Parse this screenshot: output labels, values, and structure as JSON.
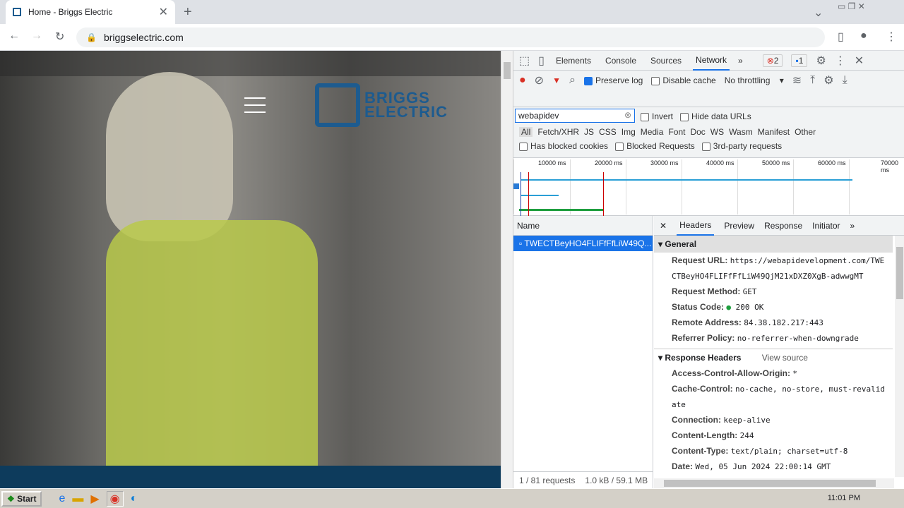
{
  "browser": {
    "tab_title": "Home - Briggs Electric",
    "url": "briggselectric.com"
  },
  "site": {
    "logo_line1": "BRIGGS",
    "logo_line2": "ELECTRIC"
  },
  "devtools": {
    "tabs": [
      "Elements",
      "Console",
      "Sources",
      "Network"
    ],
    "errors": "2",
    "messages": "1",
    "preserve_log": "Preserve log",
    "disable_cache": "Disable cache",
    "throttling": "No throttling",
    "filter_value": "webapidev",
    "invert": "Invert",
    "hide_data_urls": "Hide data URLs",
    "types": [
      "All",
      "Fetch/XHR",
      "JS",
      "CSS",
      "Img",
      "Media",
      "Font",
      "Doc",
      "WS",
      "Wasm",
      "Manifest",
      "Other"
    ],
    "blocked_cookies": "Has blocked cookies",
    "blocked_requests": "Blocked Requests",
    "third_party": "3rd-party requests",
    "ticks": [
      "10000 ms",
      "20000 ms",
      "30000 ms",
      "40000 ms",
      "50000 ms",
      "60000 ms",
      "70000 ms"
    ],
    "name_header": "Name",
    "request_name": "TWECTBeyHO4FLIFfFfLiW49Q...",
    "status_requests": "1 / 81 requests",
    "status_size": "1.0 kB / 59.1 MB",
    "detail_tabs": [
      "Headers",
      "Preview",
      "Response",
      "Initiator"
    ],
    "general_title": "General",
    "general": [
      {
        "k": "Request URL:",
        "v": "https://webapidevelopment.com/TWE"
      },
      {
        "k": "",
        "v": "CTBeyHO4FLIFfFfLiW49QjM21xDXZ0XgB-adwwgMT"
      },
      {
        "k": "Request Method:",
        "v": "GET"
      },
      {
        "k": "Status Code:",
        "v": "200 OK"
      },
      {
        "k": "Remote Address:",
        "v": "84.38.182.217:443"
      },
      {
        "k": "Referrer Policy:",
        "v": "no-referrer-when-downgrade"
      }
    ],
    "response_title": "Response Headers",
    "view_source": "View source",
    "response": [
      {
        "k": "Access-Control-Allow-Origin:",
        "v": "*"
      },
      {
        "k": "Cache-Control:",
        "v": "no-cache, no-store, must-revalid"
      },
      {
        "k": "",
        "v": "ate"
      },
      {
        "k": "Connection:",
        "v": "keep-alive"
      },
      {
        "k": "Content-Length:",
        "v": "244"
      },
      {
        "k": "Content-Type:",
        "v": "text/plain; charset=utf-8"
      },
      {
        "k": "Date:",
        "v": "Wed, 05 Jun 2024 22:00:14 GMT"
      }
    ]
  },
  "taskbar": {
    "start": "Start",
    "clock": "11:01 PM"
  }
}
